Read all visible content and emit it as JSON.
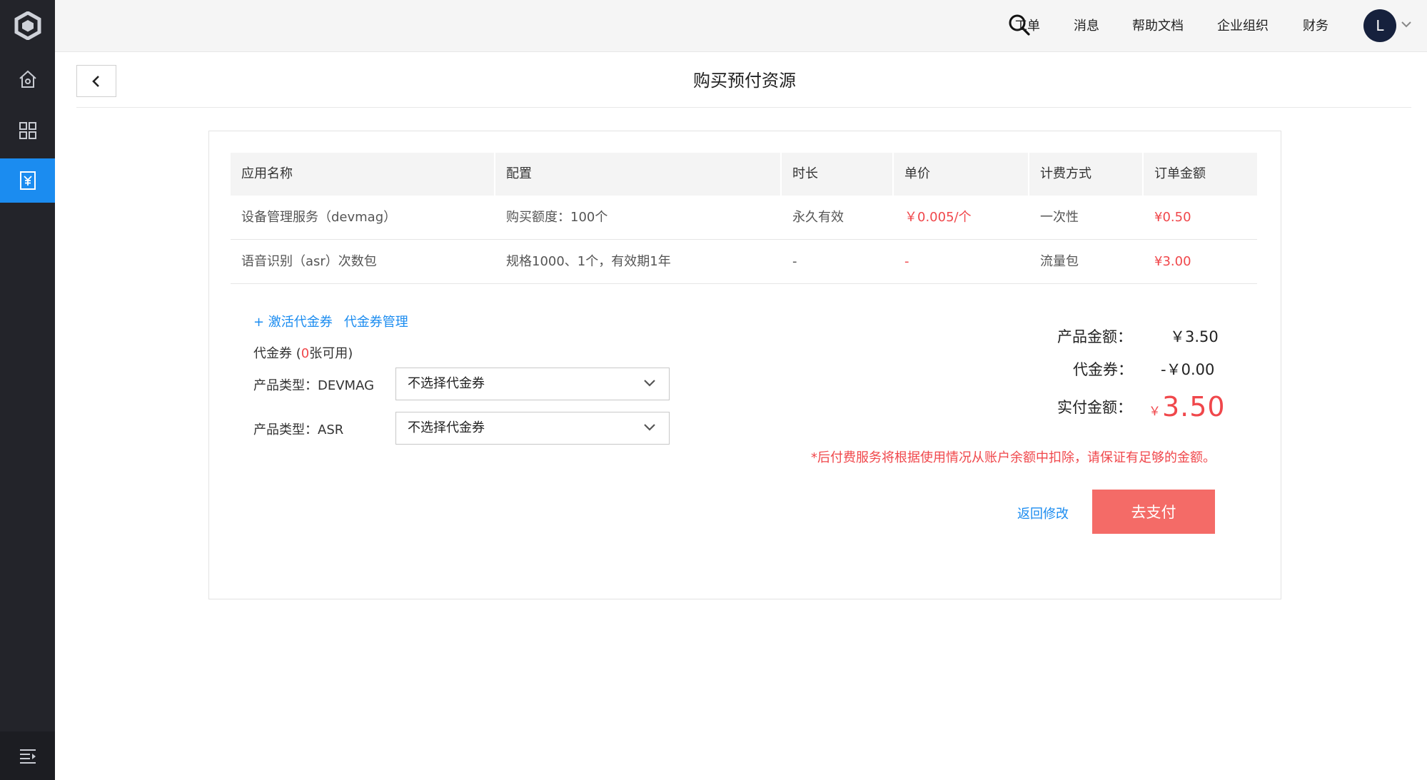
{
  "header": {
    "nav": [
      "工单",
      "消息",
      "帮助文档",
      "企业组织",
      "财务"
    ],
    "avatar_initial": "L"
  },
  "page": {
    "title": "购买预付资源"
  },
  "table": {
    "columns": [
      "应用名称",
      "配置",
      "时长",
      "单价",
      "计费方式",
      "订单金额"
    ],
    "rows": [
      [
        "设备管理服务（devmag）",
        "购买额度：100个",
        "永久有效",
        "￥0.005/个",
        "一次性",
        "¥0.50"
      ],
      [
        "语音识别（asr）次数包",
        "规格1000、1个，有效期1年",
        "-",
        "-",
        "流量包",
        "¥3.00"
      ]
    ]
  },
  "vouchers": {
    "activate_link": "+ 激活代金券",
    "manage_link": "代金券管理",
    "count_prefix": "代金券 (",
    "count": "0",
    "count_suffix": "张可用)",
    "rows": [
      {
        "label": "产品类型：DEVMAG",
        "selected": "不选择代金券"
      },
      {
        "label": "产品类型：ASR",
        "selected": "不选择代金券"
      }
    ]
  },
  "summary": {
    "product_label": "产品金额：",
    "product_value": "￥3.50",
    "voucher_label": "代金券：",
    "voucher_value": "-￥0.00",
    "paid_label": "实付金额：",
    "paid_currency": "￥",
    "paid_value": "3.50",
    "notice": "*后付费服务将根据使用情况从账户余额中扣除，请保证有足够的金额。"
  },
  "actions": {
    "back_label": "返回修改",
    "pay_label": "去支付"
  },
  "colors": {
    "sidebar_bg": "#23242a",
    "accent_blue": "#1b8cf0",
    "price_red": "#f0474b",
    "pay_button": "#f46b67"
  }
}
